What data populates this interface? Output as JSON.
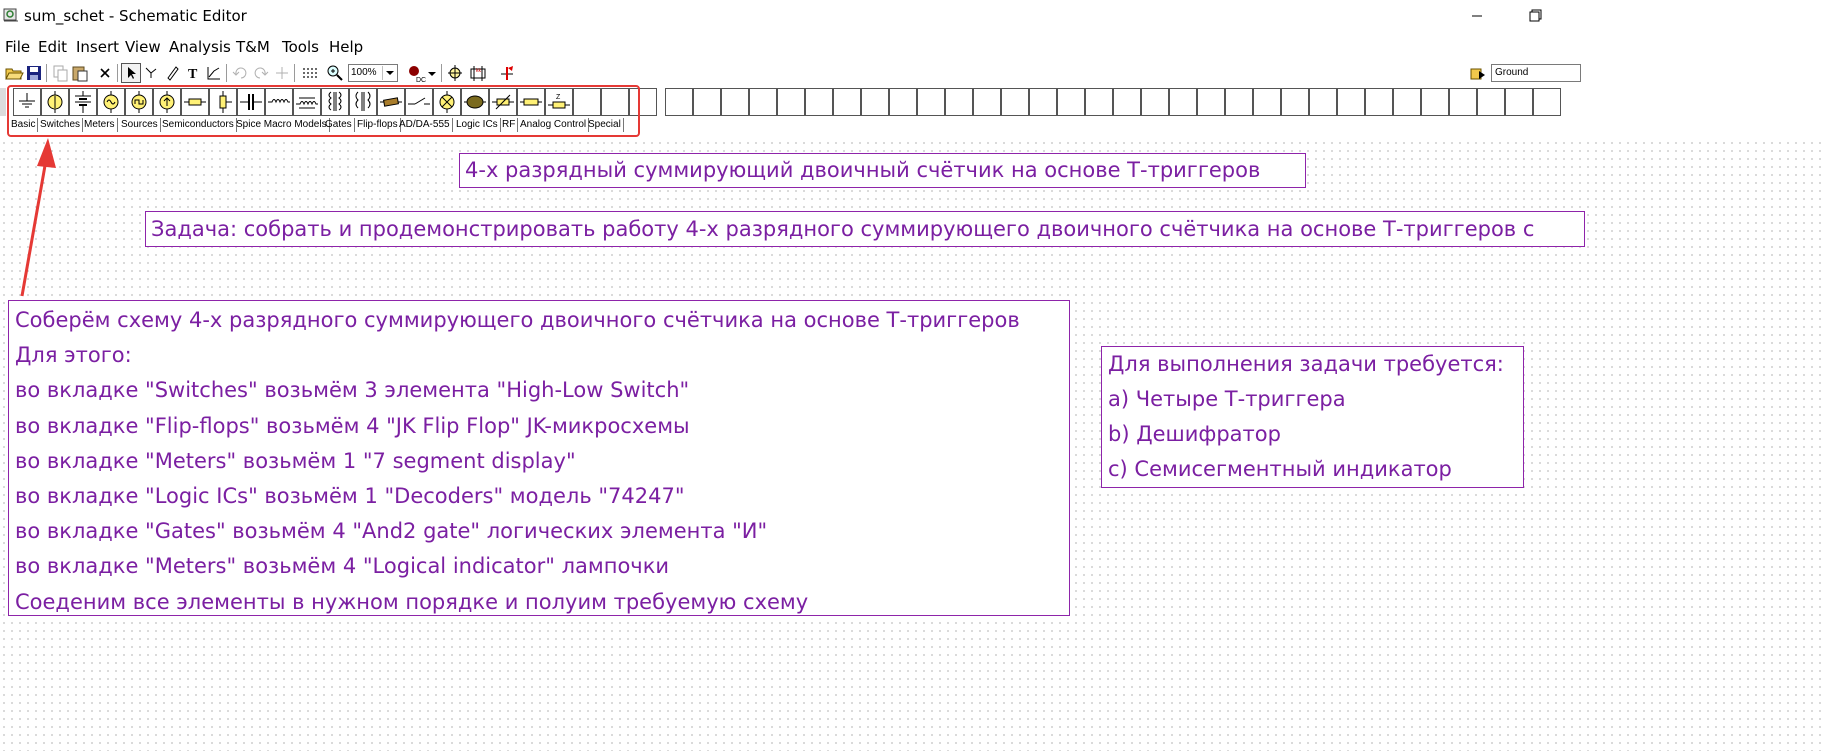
{
  "window": {
    "title": "sum_schet - Schematic Editor"
  },
  "menu": [
    "File",
    "Edit",
    "Insert",
    "View",
    "Analysis",
    "T&M",
    "Tools",
    "Help"
  ],
  "toolbar": {
    "zoom": "100%",
    "ground_field": "Ground"
  },
  "palette": {
    "tabs": [
      "Basic",
      "Switches",
      "Meters",
      "Sources",
      "Semiconductors",
      "Spice Macro Models",
      "Gates",
      "Flip-flops",
      "AD/DA-555",
      "Logic ICs",
      "RF",
      "Analog Control",
      "Special"
    ]
  },
  "canvas": {
    "title_box": "4-х разрядный суммирующий двоичный счётчик на основе Т-триггеров",
    "task_box": "Задача: собрать и продемонстрировать работу 4-х разрядного суммирующего двоичного счётчика на основе Т-триггеров с",
    "steps_box": [
      "Соберём схему 4-х разрядного суммирующего двоичного счётчика на основе Т-триггеров",
      "Для этого:",
      "во вкладке \"Switches\" возьмём 3 элемента \"High-Low Switch\"",
      "во вкладке \"Flip-flops\" возьмём 4 \"JK Flip Flop\" JK-микросхемы",
      "во вкладке \"Meters\" возьмём 1 \"7 segment display\"",
      "во вкладке \"Logic ICs\" возьмём 1  \"Decoders\" модель \"74247\"",
      "во вкладке \"Gates\" возьмём 4 \"And2 gate\" логических элемента \"И\"",
      "во вкладке \"Meters\" возьмём 4 \"Logical indicator\" лампочки",
      "Соеденим все элементы в нужном порядке и полуим требуемую схему"
    ],
    "requirements_box": [
      "Для выполнения задачи требуется:",
      "a) Четыре Т-триггера",
      "b) Дешифратор",
      "c) Семисегментный индикатор"
    ]
  },
  "colors": {
    "text_purple": "#7b1fa2",
    "box_border": "#8e24aa",
    "annotation_red": "#e53935"
  }
}
